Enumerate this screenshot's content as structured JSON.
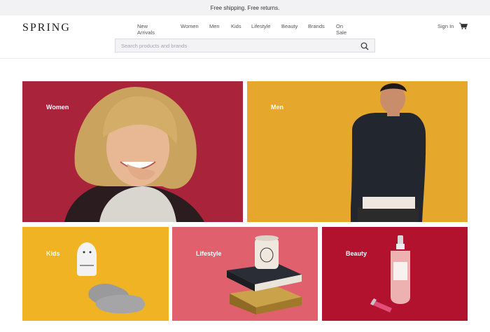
{
  "promo": {
    "text": "Free shipping. Free returns."
  },
  "header": {
    "logo": "SPRING",
    "nav": [
      "New Arrivals",
      "Women",
      "Men",
      "Kids",
      "Lifestyle",
      "Beauty",
      "Brands",
      "On Sale"
    ],
    "sign_in": "Sign In",
    "cart_icon": "shopping-cart-icon"
  },
  "search": {
    "placeholder": "Search products and brands",
    "value": "",
    "icon": "search-icon"
  },
  "categories": [
    {
      "label": "Women",
      "color": "#a9233b"
    },
    {
      "label": "Men",
      "color": "#e6a72d"
    },
    {
      "label": "Kids",
      "color": "#f0b323"
    },
    {
      "label": "Lifestyle",
      "color": "#e0606e"
    },
    {
      "label": "Beauty",
      "color": "#b3122e"
    }
  ]
}
